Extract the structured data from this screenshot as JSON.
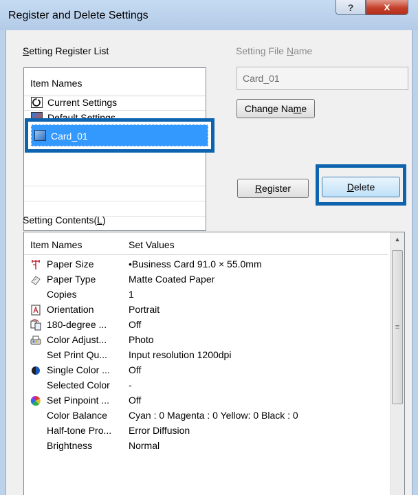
{
  "window": {
    "title": "Register and Delete Settings",
    "help_glyph": "?",
    "close_glyph": "x"
  },
  "register_list": {
    "label_u": "S",
    "label_rest": "etting Register List",
    "header": "Item Names",
    "items": [
      {
        "label": "Current Settings",
        "icon": "current-settings-icon"
      },
      {
        "label": "Default Settings",
        "icon": "default-settings-icon"
      },
      {
        "label": "Card_01",
        "icon": "card-settings-icon",
        "selected": true
      }
    ]
  },
  "file_name": {
    "label_before": "Setting File ",
    "label_u": "N",
    "label_after": "ame",
    "value": "Card_01"
  },
  "buttons": {
    "change_before": "Change Na",
    "change_u": "m",
    "change_after": "e",
    "register_u": "R",
    "register_rest": "egister",
    "delete_u": "D",
    "delete_rest": "elete"
  },
  "contents": {
    "label_before": "Setting Contents(",
    "label_u": "L",
    "label_after": ")",
    "col_name": "Item Names",
    "col_value": "Set Values",
    "rows": [
      {
        "name": "Paper Size",
        "value": "•Business Card 91.0 × 55.0mm",
        "icon": "paper-size-icon"
      },
      {
        "name": "Paper Type",
        "value": "Matte Coated Paper",
        "icon": "paper-type-icon"
      },
      {
        "name": "Copies",
        "value": "1",
        "icon": ""
      },
      {
        "name": "Orientation",
        "value": "Portrait",
        "icon": "orientation-icon"
      },
      {
        "name": "180-degree ...",
        "value": "Off",
        "icon": "rotate-180-icon"
      },
      {
        "name": "Color Adjust...",
        "value": "Photo",
        "icon": "color-adjust-icon"
      },
      {
        "name": "Set Print Qu...",
        "value": "Input resolution 1200dpi",
        "icon": ""
      },
      {
        "name": "Single Color ...",
        "value": "Off",
        "icon": "single-color-icon"
      },
      {
        "name": "Selected Color",
        "value": "-",
        "icon": ""
      },
      {
        "name": "Set Pinpoint ...",
        "value": "Off",
        "icon": "pinpoint-color-icon"
      },
      {
        "name": "Color Balance",
        "value": "Cyan : 0 Magenta : 0 Yellow: 0 Black : 0",
        "icon": ""
      },
      {
        "name": "Half-tone Pro...",
        "value": "Error Diffusion",
        "icon": ""
      },
      {
        "name": "Brightness",
        "value": "Normal",
        "icon": ""
      }
    ]
  },
  "colors": {
    "highlight": "#0d63ad",
    "selection": "#3399ff",
    "title_bar": "#bcd2ea",
    "close_button": "#c4402a"
  }
}
